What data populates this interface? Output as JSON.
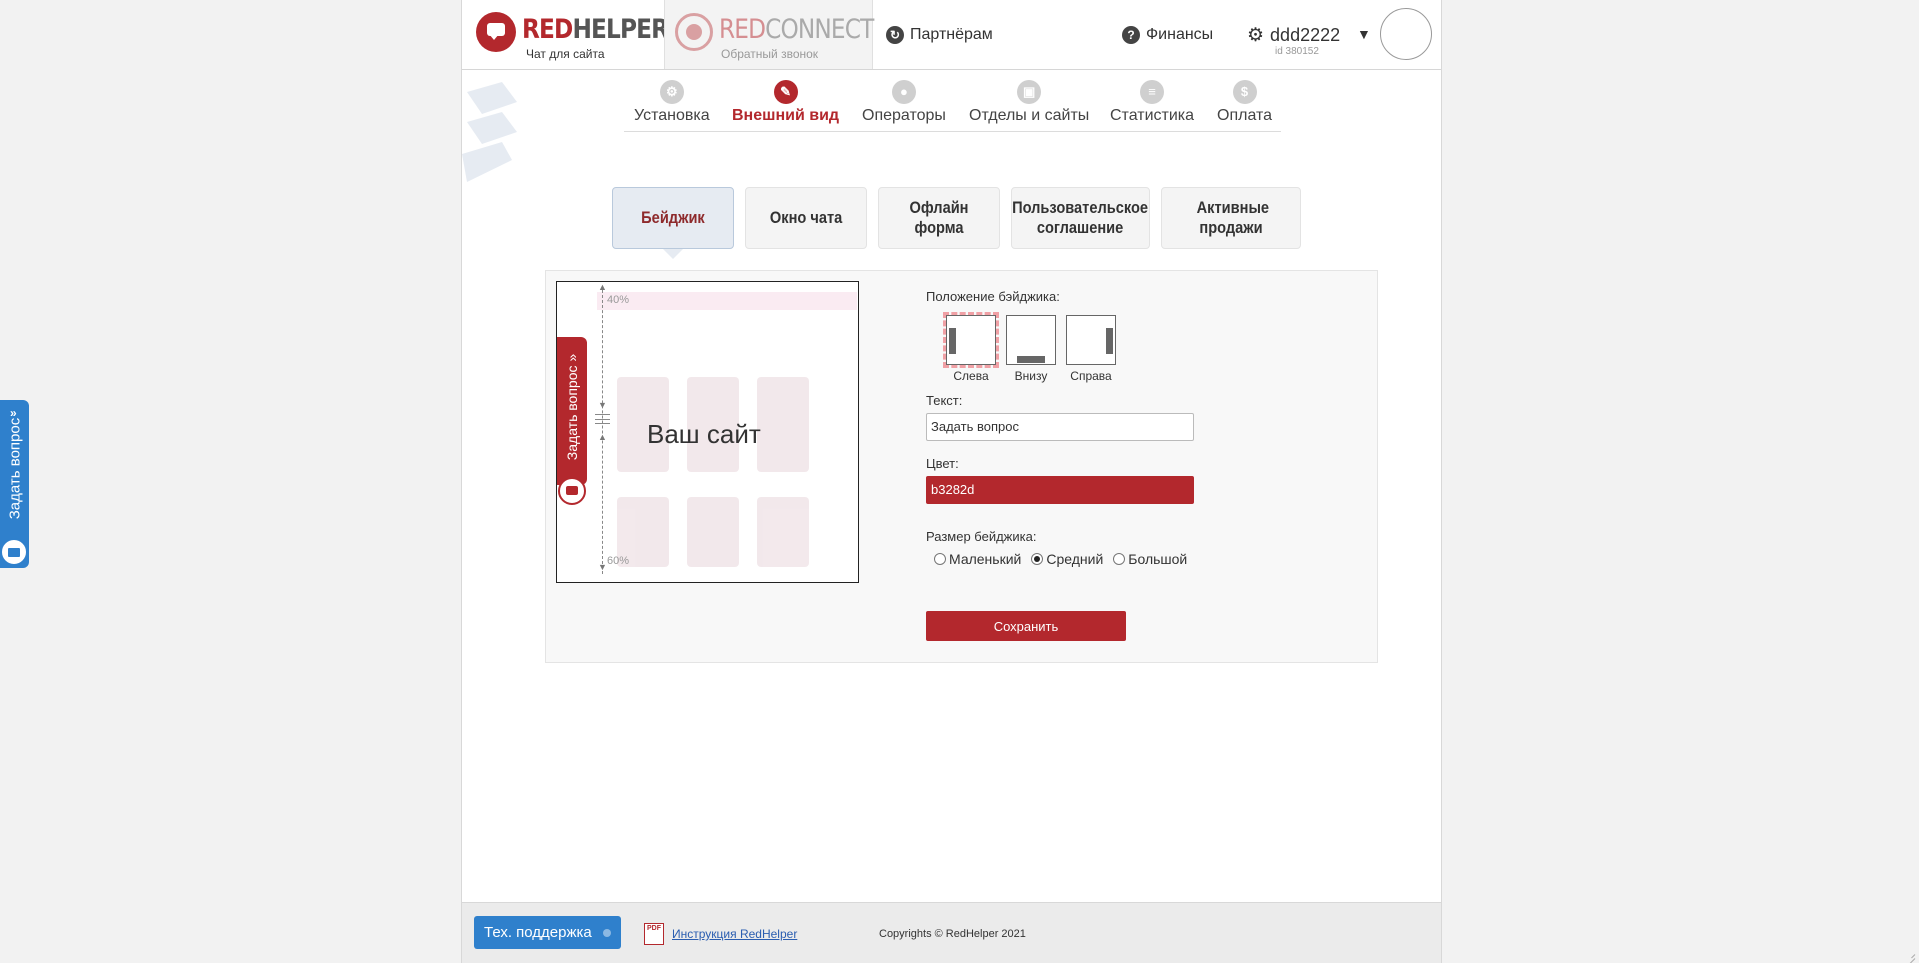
{
  "header": {
    "redhelper_logo_part1": "RED",
    "redhelper_logo_part2": "HELPER",
    "redhelper_sub": "Чат для сайта",
    "redconnect_logo_part1": "RED",
    "redconnect_logo_part2": "CONNECT",
    "redconnect_sub": "Обратный звонок",
    "partners_label": "Партнёрам",
    "finance_label": "Финансы",
    "username": "ddd2222",
    "user_id": "id 380152",
    "dropdown_arrow": "▼"
  },
  "nav": {
    "items": [
      {
        "label": "Установка",
        "icon": "gear-icon"
      },
      {
        "label": "Внешний вид",
        "icon": "wrench-icon"
      },
      {
        "label": "Операторы",
        "icon": "user-icon"
      },
      {
        "label": "Отделы и сайты",
        "icon": "monitor-icon"
      },
      {
        "label": "Статистика",
        "icon": "stats-icon"
      },
      {
        "label": "Оплата",
        "icon": "dollar-icon"
      }
    ],
    "active_index": 1
  },
  "tabs": {
    "badge": "Бейджик",
    "chat_window": "Окно чата",
    "offline_form": "Офлайн форма",
    "user_agreement": "Пользовательское соглашение",
    "active_sales": "Активные продажи"
  },
  "preview": {
    "site_label": "Ваш сайт",
    "top_percent": "40%",
    "bottom_percent": "60%",
    "badge_text": "Задать вопрос »"
  },
  "form": {
    "position_label": "Положение бэйджика:",
    "positions": [
      "Слева",
      "Внизу",
      "Справа"
    ],
    "position_selected": "Слева",
    "text_label": "Текст:",
    "text_value": "Задать вопрос",
    "color_label": "Цвет:",
    "color_value": "b3282d",
    "size_label": "Размер бейджика:",
    "sizes": [
      "Маленький",
      "Средний",
      "Большой"
    ],
    "size_selected": "Средний",
    "save_label": "Сохранить"
  },
  "footer": {
    "support_label": "Тех. поддержка",
    "pdf_icon_text": "PDF",
    "manual_link": "Инструкция RedHelper",
    "copyright": "Copyrights © RedHelper 2021"
  },
  "side_badge": {
    "text": "Задать вопрос",
    "chevron": "»"
  },
  "colors": {
    "brand_red": "#b3282d",
    "support_blue": "#2f80cc"
  }
}
